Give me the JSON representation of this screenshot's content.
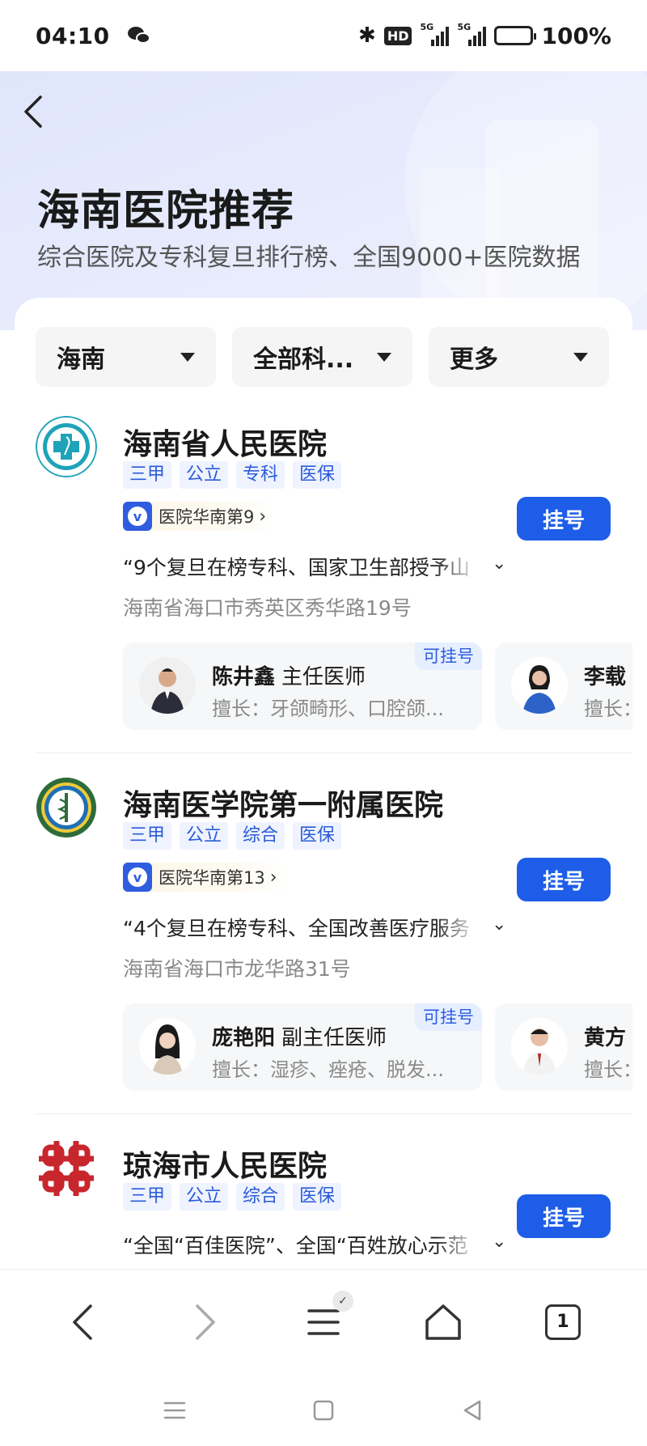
{
  "status": {
    "time": "04:10",
    "hd": "HD",
    "sim1": "5G",
    "sim2": "5G",
    "battery": "100%"
  },
  "header": {
    "title": "海南医院推荐",
    "subtitle": "综合医院及专科复旦排行榜、全国9000+医院数据"
  },
  "filters": [
    {
      "label": "海南"
    },
    {
      "label": "全部科..."
    },
    {
      "label": "更多"
    }
  ],
  "hospitals": [
    {
      "name": "海南省人民医院",
      "tags": [
        "三甲",
        "公立",
        "专科",
        "医保"
      ],
      "rank": "医院华南第9",
      "register": "挂号",
      "quote": "“9个复旦在榜专科、国家卫生部授予山",
      "address": "海南省海口市秀英区秀华路19号",
      "doctors": [
        {
          "name": "陈井鑫",
          "title": "主任医师",
          "specialty": "擅长：牙颌畸形、口腔颌...",
          "badge": "可挂号"
        },
        {
          "name": "李载",
          "title": "",
          "specialty": "擅长：",
          "badge": ""
        }
      ]
    },
    {
      "name": "海南医学院第一附属医院",
      "tags": [
        "三甲",
        "公立",
        "综合",
        "医保"
      ],
      "rank": "医院华南第13",
      "register": "挂号",
      "quote": "“4个复旦在榜专科、全国改善医疗服务",
      "address": "海南省海口市龙华路31号",
      "doctors": [
        {
          "name": "庞艳阳",
          "title": "副主任医师",
          "specialty": "擅长：湿疹、痤疮、脱发...",
          "badge": "可挂号"
        },
        {
          "name": "黄方",
          "title": "",
          "specialty": "擅长：",
          "badge": ""
        }
      ]
    },
    {
      "name": "琼海市人民医院",
      "tags": [
        "三甲",
        "公立",
        "综合",
        "医保"
      ],
      "register": "挂号",
      "quote": "“全国“百佳医院”、全国“百姓放心示范"
    }
  ],
  "browser": {
    "tabs_count": "1"
  }
}
